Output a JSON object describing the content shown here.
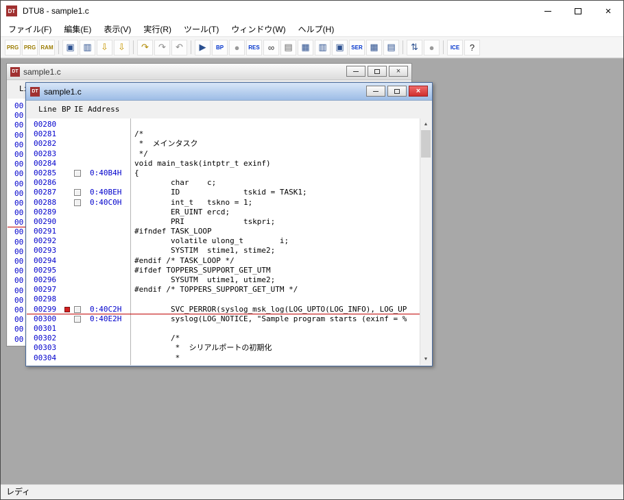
{
  "titlebar": {
    "icon_text": "DT",
    "title": "DTU8 - sample1.c"
  },
  "menubar": {
    "items": [
      {
        "id": "file",
        "label": "ファイル(F)"
      },
      {
        "id": "edit",
        "label": "編集(E)"
      },
      {
        "id": "view",
        "label": "表示(V)"
      },
      {
        "id": "run",
        "label": "実行(R)"
      },
      {
        "id": "tools",
        "label": "ツール(T)"
      },
      {
        "id": "window",
        "label": "ウィンドウ(W)"
      },
      {
        "id": "help",
        "label": "ヘルプ(H)"
      }
    ]
  },
  "toolbar": {
    "items": [
      {
        "name": "prg-read-button",
        "glyph": "PRG",
        "color": "#9a7b00"
      },
      {
        "name": "prg-write-button",
        "glyph": "PRG",
        "color": "#9a7b00"
      },
      {
        "name": "ram-monitor-button",
        "glyph": "RAM",
        "color": "#9a7b00"
      },
      {
        "sep": true
      },
      {
        "name": "source-window-button",
        "glyph": "▣",
        "color": "#2a4f8f"
      },
      {
        "name": "dump-window-button",
        "glyph": "▥",
        "color": "#2a4f8f"
      },
      {
        "name": "download-button",
        "glyph": "⇩",
        "color": "#c79600"
      },
      {
        "name": "upload-button",
        "glyph": "⇩",
        "color": "#c79600"
      },
      {
        "sep": true
      },
      {
        "name": "step-into-button",
        "glyph": "↷",
        "color": "#b08900"
      },
      {
        "name": "step-over-button",
        "glyph": "↷",
        "color": "#8a8a8a"
      },
      {
        "name": "step-out-button",
        "glyph": "↶",
        "color": "#8a8a8a"
      },
      {
        "sep": true
      },
      {
        "name": "go-button",
        "glyph": "▶",
        "color": "#2a4f8f"
      },
      {
        "name": "breakpoint-button",
        "glyph": "BP",
        "color": "#0033cc"
      },
      {
        "name": "stop-button",
        "glyph": "●",
        "color": "#9a9a9a"
      },
      {
        "name": "reset-button",
        "glyph": "RES",
        "color": "#0033cc"
      },
      {
        "name": "watch-button",
        "glyph": "∞",
        "color": "#333333"
      },
      {
        "name": "print-button",
        "glyph": "▤",
        "color": "#666666"
      },
      {
        "name": "memory-window-button",
        "glyph": "▦",
        "color": "#2a4f8f"
      },
      {
        "name": "register-window-button",
        "glyph": "▥",
        "color": "#2a4f8f"
      },
      {
        "name": "io-window-button",
        "glyph": "▣",
        "color": "#2a4f8f"
      },
      {
        "name": "serial-window-button",
        "glyph": "SER",
        "color": "#0033cc"
      },
      {
        "name": "trace-window-button",
        "glyph": "▦",
        "color": "#2a4f8f"
      },
      {
        "name": "list-window-button",
        "glyph": "▤",
        "color": "#2a4f8f"
      },
      {
        "sep": true
      },
      {
        "name": "sync-button",
        "glyph": "⇅",
        "color": "#2a4f8f"
      },
      {
        "name": "stop-secondary-button",
        "glyph": "●",
        "color": "#9a9a9a"
      },
      {
        "sep": true
      },
      {
        "name": "ice-button",
        "glyph": "ICE",
        "color": "#0033cc"
      },
      {
        "name": "help-button",
        "glyph": "?",
        "color": "#222222"
      }
    ]
  },
  "mdi": {
    "back_window": {
      "icon_text": "DT",
      "title": "sample1.c",
      "header": "Line BP IE Address",
      "gutter_text": "00",
      "gutter_rows": 25,
      "red_line_after_row": 12
    },
    "front_window": {
      "icon_text": "DT",
      "title": "sample1.c",
      "header": {
        "line": "Line",
        "bp": "BP",
        "ie": "IE",
        "address": "Address"
      },
      "colors": {
        "line_number": "#0000cc",
        "address": "#0000cc",
        "breakpoint": "#d42020",
        "current_line": "#c00000"
      },
      "rows": [
        {
          "line": "00280",
          "code": ""
        },
        {
          "line": "00281",
          "code": "/*"
        },
        {
          "line": "00282",
          "code": " *  メインタスク"
        },
        {
          "line": "00283",
          "code": " */"
        },
        {
          "line": "00284",
          "code": "void main_task(intptr_t exinf)"
        },
        {
          "line": "00285",
          "addr": "0:40B4H",
          "code": "{"
        },
        {
          "line": "00286",
          "code": "        char    c;"
        },
        {
          "line": "00287",
          "addr": "0:40BEH",
          "code": "        ID              tskid = TASK1;"
        },
        {
          "line": "00288",
          "addr": "0:40C0H",
          "code": "        int_t   tskno = 1;"
        },
        {
          "line": "00289",
          "code": "        ER_UINT ercd;"
        },
        {
          "line": "00290",
          "code": "        PRI             tskpri;"
        },
        {
          "line": "00291",
          "code": "#ifndef TASK_LOOP"
        },
        {
          "line": "00292",
          "code": "        volatile ulong_t        i;"
        },
        {
          "line": "00293",
          "code": "        SYSTIM  stime1, stime2;"
        },
        {
          "line": "00294",
          "code": "#endif /* TASK_LOOP */"
        },
        {
          "line": "00295",
          "code": "#ifdef TOPPERS_SUPPORT_GET_UTM"
        },
        {
          "line": "00296",
          "code": "        SYSUTM  utime1, utime2;"
        },
        {
          "line": "00297",
          "code": "#endif /* TOPPERS_SUPPORT_GET_UTM */"
        },
        {
          "line": "00298",
          "code": ""
        },
        {
          "line": "00299",
          "addr": "0:40C2H",
          "bp": true,
          "current": true,
          "code": "        SVC_PERROR(syslog_msk_log(LOG_UPTO(LOG_INFO), LOG_UP"
        },
        {
          "line": "00300",
          "addr": "0:40E2H",
          "code": "        syslog(LOG_NOTICE, \"Sample program starts (exinf = %"
        },
        {
          "line": "00301",
          "code": ""
        },
        {
          "line": "00302",
          "code": "        /*"
        },
        {
          "line": "00303",
          "code": "         *  シリアルポートの初期化"
        },
        {
          "line": "00304",
          "code": "         *"
        }
      ]
    }
  },
  "icons": {
    "close": "×",
    "child_close": "×",
    "scroll_up": "▲",
    "scroll_down": "▼"
  },
  "statusbar": {
    "text": "レディ"
  }
}
